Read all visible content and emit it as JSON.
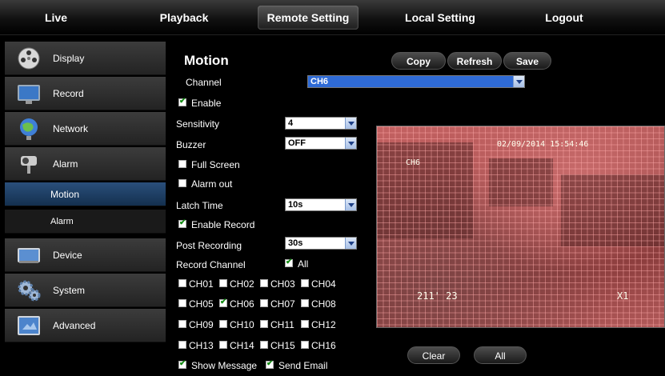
{
  "topnav": {
    "live": "Live",
    "playback": "Playback",
    "remote_setting": "Remote Setting",
    "local_setting": "Local Setting",
    "logout": "Logout",
    "active": "Remote Setting"
  },
  "sidebar": {
    "items": [
      {
        "label": "Display",
        "icon": "film-reel-icon"
      },
      {
        "label": "Record",
        "icon": "monitor-icon"
      },
      {
        "label": "Network",
        "icon": "globe-icon"
      },
      {
        "label": "Alarm",
        "icon": "camera-icon"
      },
      {
        "label": "Device",
        "icon": "hard-drive-icon"
      },
      {
        "label": "System",
        "icon": "gears-icon"
      },
      {
        "label": "Advanced",
        "icon": "screen-icon"
      }
    ],
    "subitems": [
      {
        "label": "Motion",
        "selected": true
      },
      {
        "label": "Alarm",
        "selected": false
      }
    ]
  },
  "main": {
    "title": "Motion",
    "buttons": {
      "copy": "Copy",
      "refresh": "Refresh",
      "save": "Save"
    },
    "channel": {
      "label": "Channel",
      "value": "CH6"
    },
    "enable": {
      "label": "Enable",
      "checked": true
    },
    "sensitivity": {
      "label": "Sensitivity",
      "value": "4"
    },
    "buzzer": {
      "label": "Buzzer",
      "value": "OFF"
    },
    "full_screen": {
      "label": "Full Screen",
      "checked": false
    },
    "alarm_out": {
      "label": "Alarm out",
      "checked": false
    },
    "latch_time": {
      "label": "Latch Time",
      "value": "10s"
    },
    "enable_record": {
      "label": "Enable Record",
      "checked": true
    },
    "post_recording": {
      "label": "Post Recording",
      "value": "30s"
    },
    "record_channel": {
      "label": "Record Channel",
      "all_label": "All",
      "all_checked": true
    },
    "channels": [
      {
        "label": "CH01",
        "checked": false
      },
      {
        "label": "CH02",
        "checked": false
      },
      {
        "label": "CH03",
        "checked": false
      },
      {
        "label": "CH04",
        "checked": false
      },
      {
        "label": "CH05",
        "checked": false
      },
      {
        "label": "CH06",
        "checked": true
      },
      {
        "label": "CH07",
        "checked": false
      },
      {
        "label": "CH08",
        "checked": false
      },
      {
        "label": "CH09",
        "checked": false
      },
      {
        "label": "CH10",
        "checked": false
      },
      {
        "label": "CH11",
        "checked": false
      },
      {
        "label": "CH12",
        "checked": false
      },
      {
        "label": "CH13",
        "checked": false
      },
      {
        "label": "CH14",
        "checked": false
      },
      {
        "label": "CH15",
        "checked": false
      },
      {
        "label": "CH16",
        "checked": false
      }
    ],
    "show_message": {
      "label": "Show Message",
      "checked": true
    },
    "send_email": {
      "label": "Send Email",
      "checked": true
    },
    "preview": {
      "timestamp": "02/09/2014 15:54:46",
      "channel_name": "CH6",
      "overlay_left": "211' 23",
      "overlay_right": "X1"
    },
    "clear_label": "Clear",
    "all_label": "All"
  },
  "colors": {
    "accent": "#2f6bd6",
    "selected_row": "#1f406a",
    "motion_overlay": "#c46262"
  }
}
